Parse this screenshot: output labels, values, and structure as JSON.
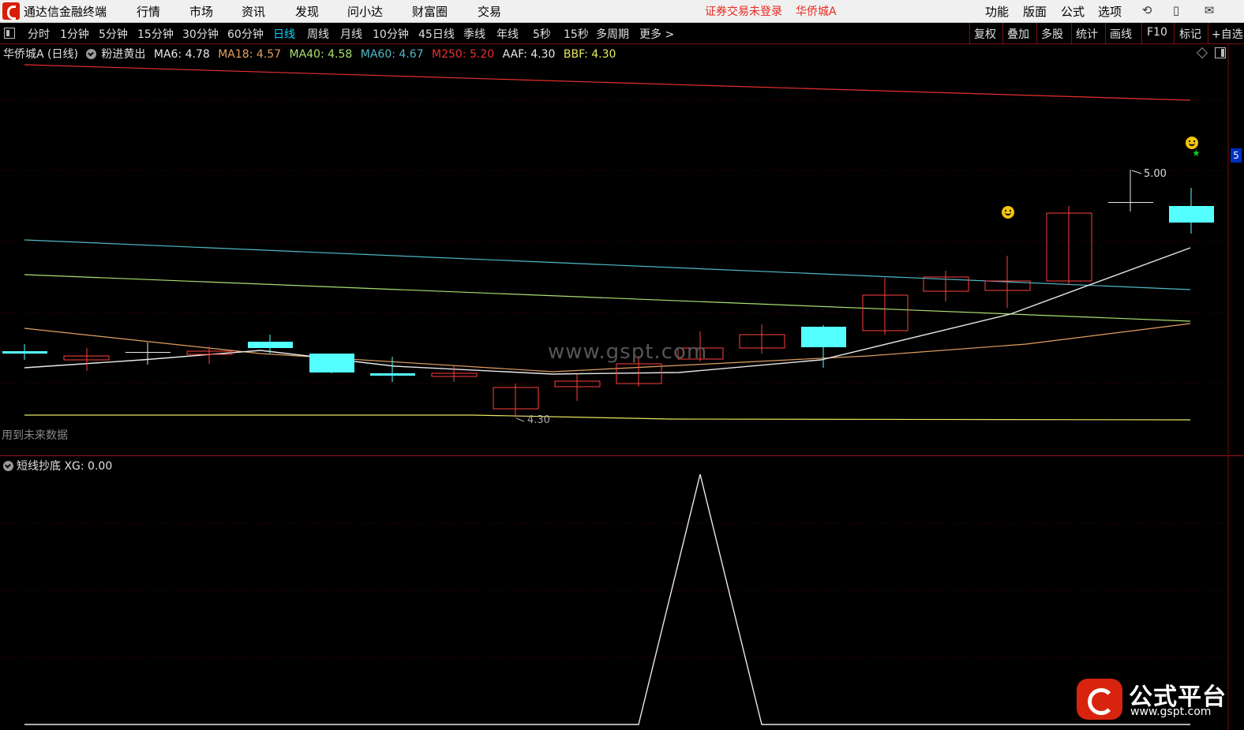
{
  "menubar": {
    "app_title": "通达信金融终端",
    "items": [
      "行情",
      "市场",
      "资讯",
      "发现",
      "问小达",
      "财富圈",
      "交易"
    ],
    "status_text": "证券交易未登录",
    "stock_name": "华侨城A",
    "right_items": [
      "功能",
      "版面",
      "公式",
      "选项"
    ]
  },
  "periodbar": {
    "periods": [
      "分时",
      "1分钟",
      "5分钟",
      "15分钟",
      "30分钟",
      "60分钟",
      "日线",
      "周线",
      "月线",
      "10分钟",
      "45日线",
      "季线",
      "年线",
      "5秒",
      "15秒",
      "多周期",
      "更多 >"
    ],
    "active": "日线",
    "right_tools": [
      "复权",
      "叠加",
      "多股",
      "统计",
      "画线",
      "F10",
      "标记",
      "+自选"
    ]
  },
  "main_chart": {
    "stock_label": "华侨城A (日线)",
    "indicator_name": "粉进黄出",
    "indicators": [
      {
        "label": "MA6: 4.78",
        "color": "#e8e8e8"
      },
      {
        "label": "MA18: 4.57",
        "color": "#e0a060"
      },
      {
        "label": "MA40: 4.58",
        "color": "#a8e070"
      },
      {
        "label": "MA60: 4.67",
        "color": "#50b8c8"
      },
      {
        "label": "M250: 5.20",
        "color": "#e83030"
      },
      {
        "label": "AAF: 4.30",
        "color": "#e8e8e8"
      },
      {
        "label": "BBF: 4.30",
        "color": "#e8e860"
      }
    ],
    "watermark": "www.gspt.com",
    "note": "用到未来数据",
    "high_label": "5.00",
    "low_label": "4.30",
    "right_tag": "5"
  },
  "sub_chart": {
    "title": "短线抄底",
    "value_label": "XG: 0.00"
  },
  "brand": {
    "name": "公式平台",
    "url": "www.gspt.com"
  },
  "colors": {
    "up": "#ff4040",
    "down": "#54ffff",
    "grid": "#3a0000"
  }
}
